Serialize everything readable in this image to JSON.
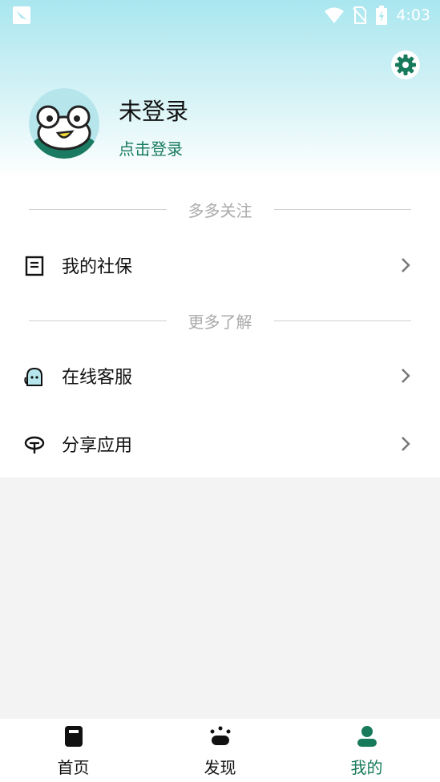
{
  "status_bar": {
    "time": "4:03"
  },
  "profile": {
    "name": "未登录",
    "login_link": "点击登录"
  },
  "sections": [
    {
      "title": "多多关注",
      "items": [
        {
          "label": "我的社保",
          "icon": "document-icon"
        }
      ]
    },
    {
      "title": "更多了解",
      "items": [
        {
          "label": "在线客服",
          "icon": "customer-service-icon"
        },
        {
          "label": "分享应用",
          "icon": "share-icon"
        }
      ]
    }
  ],
  "bottom_nav": [
    {
      "label": "首页",
      "icon": "home-book-icon",
      "active": false
    },
    {
      "label": "发现",
      "icon": "discover-icon",
      "active": false
    },
    {
      "label": "我的",
      "icon": "person-icon",
      "active": true
    }
  ],
  "colors": {
    "accent": "#177a5b",
    "header_top": "#a9e6ef",
    "page_bg": "#f3f3f3"
  }
}
